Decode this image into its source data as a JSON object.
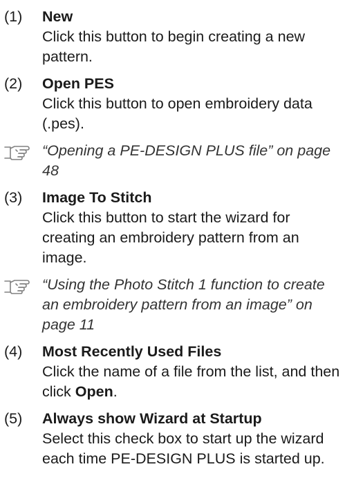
{
  "items": [
    {
      "num": "(1)",
      "title": "New",
      "desc": "Click this button to begin creating a new pattern."
    },
    {
      "num": "(2)",
      "title": "Open PES",
      "desc": "Click this button to open embroidery data (.pes)."
    },
    {
      "num": "(3)",
      "title": "Image To Stitch",
      "desc": "Click this button to start the wizard for creating an embroidery pattern from an image."
    },
    {
      "num": "(4)",
      "title": "Most Recently Used Files",
      "desc_pre": "Click the name of a file from the list, and then click ",
      "desc_bold": "Open",
      "desc_post": "."
    },
    {
      "num": "(5)",
      "title": "Always show Wizard at Startup",
      "desc": "Select this check box to start up the wizard each time PE-DESIGN PLUS is started up."
    }
  ],
  "refs": [
    {
      "icon": "pointing-hand-icon",
      "text": "“Opening a PE-DESIGN PLUS file” on page 48"
    },
    {
      "icon": "pointing-hand-icon",
      "text": "“Using the Photo Stitch 1 function to create an embroidery pattern from an image” on page 11"
    }
  ]
}
